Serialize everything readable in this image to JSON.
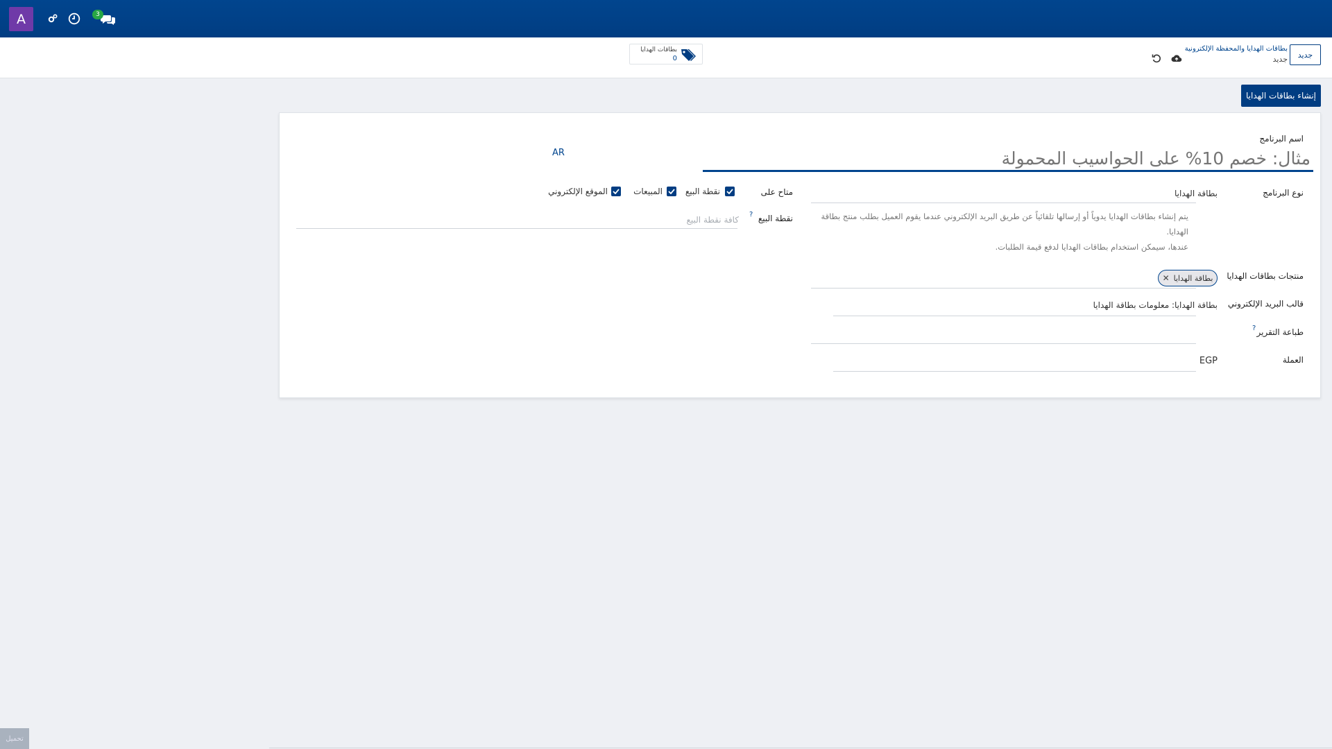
{
  "navbar": {
    "avatar_letter": "A",
    "chat_badge": "3"
  },
  "control": {
    "new_button": "جديد",
    "breadcrumb_parent": "بطاقات الهدايا والمحفظة الإلكترونية",
    "breadcrumb_current": "جديد",
    "smart_button_label": "بطاقات الهدايا",
    "smart_button_count": "0"
  },
  "actions": {
    "create_gift_cards": "إنشاء بطاقات الهدايا"
  },
  "form": {
    "program_name_label": "اسم البرنامج",
    "program_name_placeholder": "مثال: خصم 10% على الحواسيب المحمولة",
    "lang": "AR",
    "program_type_label": "نوع البرنامج",
    "program_type_value": "بطاقة الهدايا",
    "description_line1": "يتم إنشاء بطاقات الهدايا يدوياً أو إرسالها تلقائياً عن طريق البريد الإلكتروني عندما يقوم العميل بطلب منتج بطاقة الهدايا.",
    "description_line2": "عندها، سيمكن استخدام بطاقات الهدايا لدفع قيمة الطلبات.",
    "available_on_label": "متاح على",
    "available_on": [
      "نقطة البيع",
      "المبيعات",
      "الموقع الإلكتروني"
    ],
    "pos_label": "نقطة البيع",
    "pos_help": "?",
    "pos_placeholder": "كافة نقطة البيع",
    "gift_card_products_label": "منتجات بطاقات الهدايا",
    "gift_card_product_tag": "بطاقة الهدايا",
    "email_template_label": "قالب البريد الإلكتروني",
    "email_template_value": "بطاقة الهدايا: معلومات بطاقة الهدايا",
    "print_report_label": "طباعة التقرير",
    "print_report_help": "?",
    "currency_label": "العملة",
    "currency_value": "EGP"
  },
  "footer": {
    "upload_button": "تحميل"
  },
  "colors": {
    "brand": "#013d82",
    "avatar": "#6f3aa8",
    "badge": "#28a745"
  }
}
